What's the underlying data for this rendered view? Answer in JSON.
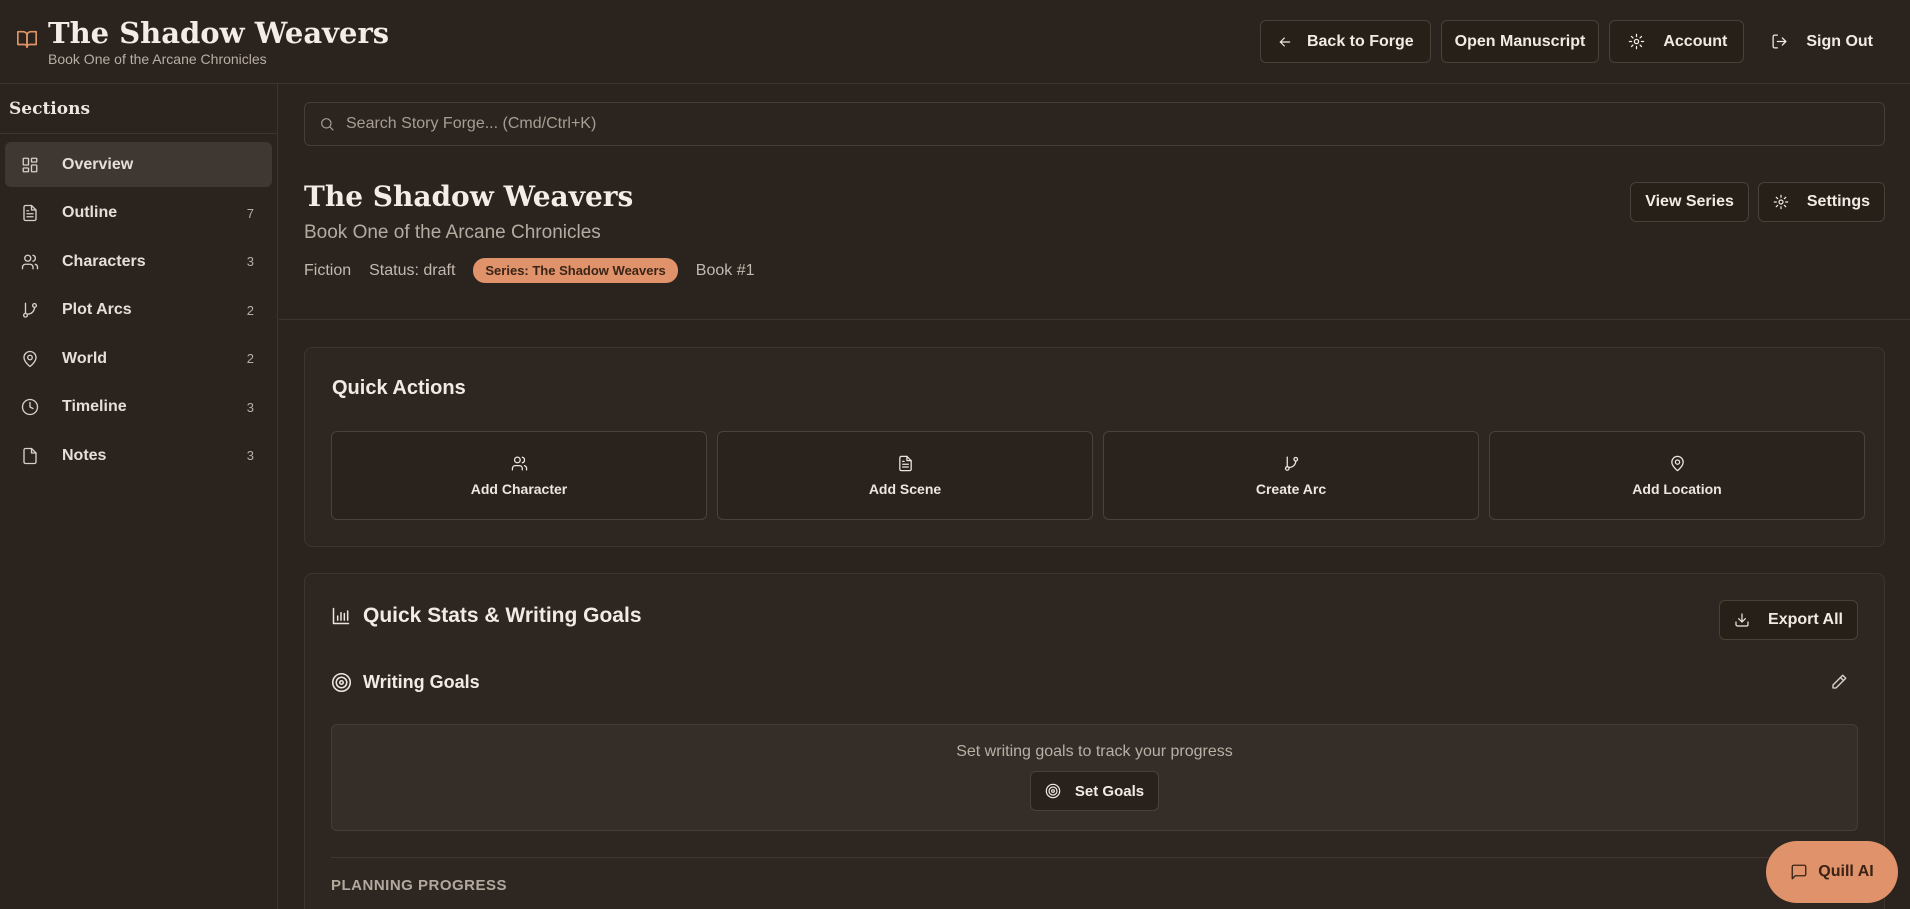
{
  "header": {
    "title": "The Shadow Weavers",
    "subtitle": "Book One of the Arcane Chronicles",
    "actions": {
      "back": "Back to Forge",
      "open": "Open Manuscript",
      "account": "Account",
      "signout": "Sign Out"
    }
  },
  "sidebar": {
    "heading": "Sections",
    "items": [
      {
        "label": "Overview",
        "count": "",
        "icon": "grid-icon",
        "active": true
      },
      {
        "label": "Outline",
        "count": "7",
        "icon": "file-text-icon"
      },
      {
        "label": "Characters",
        "count": "3",
        "icon": "users-icon"
      },
      {
        "label": "Plot Arcs",
        "count": "2",
        "icon": "git-branch-icon"
      },
      {
        "label": "World",
        "count": "2",
        "icon": "map-pin-icon"
      },
      {
        "label": "Timeline",
        "count": "3",
        "icon": "clock-icon"
      },
      {
        "label": "Notes",
        "count": "3",
        "icon": "file-icon"
      }
    ]
  },
  "search": {
    "placeholder": "Search Story Forge... (Cmd/Ctrl+K)"
  },
  "project": {
    "title": "The Shadow Weavers",
    "subtitle": "Book One of the Arcane Chronicles",
    "genre": "Fiction",
    "status": "Status: draft",
    "series": "Series: The Shadow Weavers",
    "book": "Book #1",
    "view_series": "View Series",
    "settings": "Settings"
  },
  "quick_actions": {
    "title": "Quick Actions",
    "items": [
      {
        "label": "Add Character",
        "icon": "users-icon"
      },
      {
        "label": "Add Scene",
        "icon": "file-text-icon"
      },
      {
        "label": "Create Arc",
        "icon": "git-branch-icon"
      },
      {
        "label": "Add Location",
        "icon": "map-pin-icon"
      }
    ]
  },
  "stats": {
    "title": "Quick Stats & Writing Goals",
    "export": "Export All",
    "goals_title": "Writing Goals",
    "goals_message": "Set writing goals to track your progress",
    "set_goals": "Set Goals",
    "planning_label": "PLANNING PROGRESS"
  },
  "fab": {
    "label": "Quill AI"
  },
  "colors": {
    "accent": "#e0926a",
    "background": "#2a231e",
    "card": "#2e2721"
  }
}
